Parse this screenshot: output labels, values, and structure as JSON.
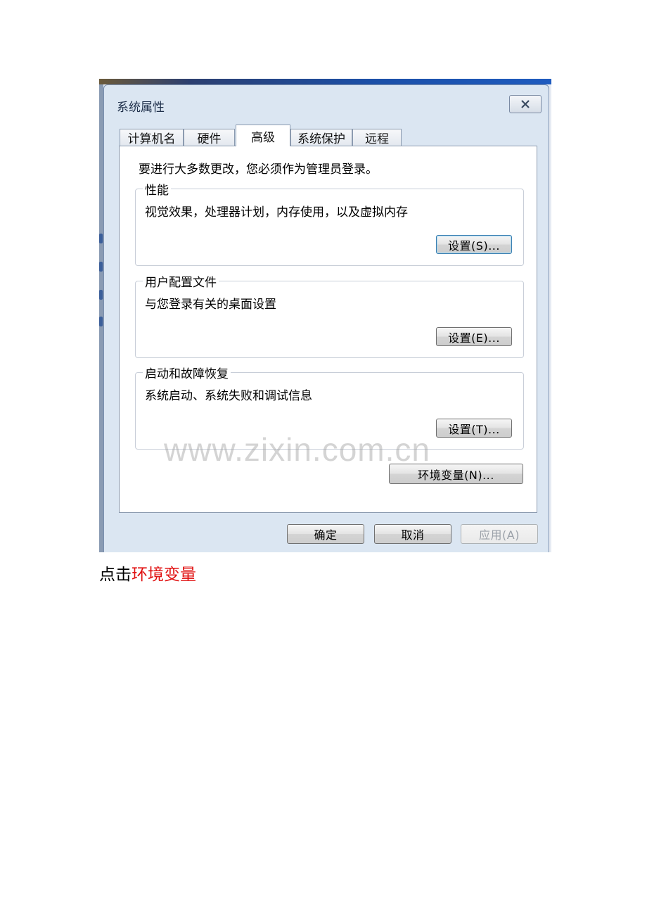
{
  "dialog": {
    "title": "系统属性",
    "close_icon": "close-icon",
    "tabs": [
      {
        "label": "计算机名",
        "active": false
      },
      {
        "label": "硬件",
        "active": false
      },
      {
        "label": "高级",
        "active": true
      },
      {
        "label": "系统保护",
        "active": false
      },
      {
        "label": "远程",
        "active": false
      }
    ],
    "intro": "要进行大多数更改，您必须作为管理员登录。",
    "groups": [
      {
        "title": "性能",
        "desc": "视觉效果，处理器计划，内存使用，以及虚拟内存",
        "button": "设置(S)..."
      },
      {
        "title": "用户配置文件",
        "desc": "与您登录有关的桌面设置",
        "button": "设置(E)..."
      },
      {
        "title": "启动和故障恢复",
        "desc": "系统启动、系统失败和调试信息",
        "button": "设置(T)..."
      }
    ],
    "env_button": "环境变量(N)...",
    "footer": {
      "ok": "确定",
      "cancel": "取消",
      "apply": "应用(A)"
    }
  },
  "watermark": "www.zixin.com.cn",
  "caption": {
    "prefix": "点击",
    "highlight": "环境变量",
    "highlight_color": "#e01010"
  }
}
